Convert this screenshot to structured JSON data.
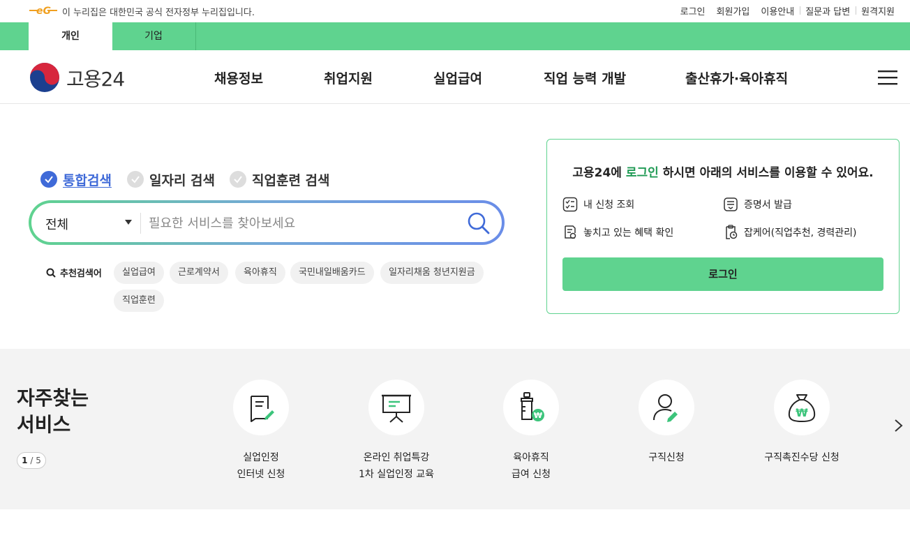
{
  "gov_bar": {
    "text": "이 누리집은 대한민국 공식 전자정부 누리집입니다.",
    "util_links": [
      "로그인",
      "회원가입",
      "이용안내",
      "질문과 답변",
      "원격지원"
    ]
  },
  "audience_tabs": [
    {
      "label": "개인",
      "active": true
    },
    {
      "label": "기업",
      "active": false
    }
  ],
  "header": {
    "logo_text": "고용24",
    "nav": [
      "채용정보",
      "취업지원",
      "실업급여",
      "직업 능력 개발",
      "출산휴가·육아휴직"
    ]
  },
  "search": {
    "tabs": [
      {
        "label": "통합검색",
        "active": true
      },
      {
        "label": "일자리 검색",
        "active": false
      },
      {
        "label": "직업훈련 검색",
        "active": false
      }
    ],
    "scope": "전체",
    "placeholder": "필요한 서비스를 찾아보세요",
    "recommended_label": "추천검색어",
    "recommended": [
      "실업급여",
      "근로계약서",
      "육아휴직",
      "국민내일배움카드",
      "일자리채움 청년지원금",
      "직업훈련"
    ]
  },
  "login_card": {
    "title_pre": "고용24에 ",
    "title_hl": "로그인",
    "title_post": " 하시면 아래의 서비스를 이용할 수 있어요.",
    "services": [
      "내 신청 조회",
      "증명서 발급",
      "놓치고 있는 혜택 확인",
      "잡케어(직업추천, 경력관리)"
    ],
    "button": "로그인"
  },
  "frequent": {
    "title_line1": "자주찾는",
    "title_line2": "서비스",
    "pager_current": "1",
    "pager_total": " / 5",
    "items": [
      {
        "line1": "실업인정",
        "line2": "인터넷 신청",
        "icon": "document-edit-icon"
      },
      {
        "line1": "온라인 취업특강",
        "line2": "1차 실업인정 교육",
        "icon": "presentation-board-icon"
      },
      {
        "line1": "육아휴직",
        "line2": "급여 신청",
        "icon": "baby-bottle-won-icon"
      },
      {
        "line1": "구직신청",
        "line2": "",
        "icon": "person-edit-icon"
      },
      {
        "line1": "구직촉진수당 신청",
        "line2": "",
        "icon": "money-bag-won-icon"
      }
    ]
  },
  "colors": {
    "brand_green": "#5fd38f",
    "accent_blue": "#3f6ad8"
  }
}
